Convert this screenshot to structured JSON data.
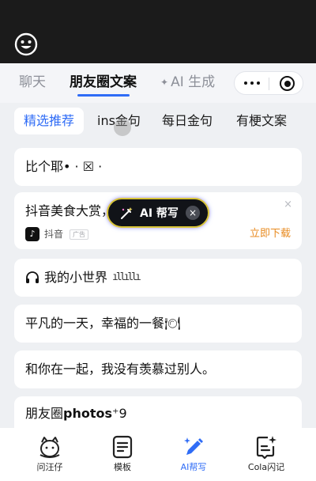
{
  "header": {
    "tabs": [
      "聊天",
      "朋友圈文案",
      "AI 生成"
    ],
    "active_tab": "朋友圈文案",
    "accent_color": "#2f6cf6"
  },
  "categories": [
    "精选推荐",
    "ins金句",
    "每日金句",
    "有梗文案"
  ],
  "active_category": "精选推荐",
  "cards": {
    "item1": "比个耶• · ☒ ·",
    "ad": {
      "text": "抖音美食大赏，带你…盛宴!",
      "source": "抖音",
      "tag": "广告",
      "action": "立即下载",
      "close": "×"
    },
    "item3": "我的小世界",
    "item3_bars": "ıllıllı",
    "item4": "平凡的一天，幸福的一餐🍽",
    "item5": "和你在一起，我没有羡慕过别人。",
    "item6": "朋友圈𝗽𝗵𝗼𝘁𝗼𝘀⁺9"
  },
  "floating_ai": {
    "label": "AI 帮写",
    "close": "×"
  },
  "bottom_nav": {
    "items": [
      "问汪仔",
      "模板",
      "AI帮写",
      "Cola闪记"
    ],
    "active": "AI帮写"
  }
}
